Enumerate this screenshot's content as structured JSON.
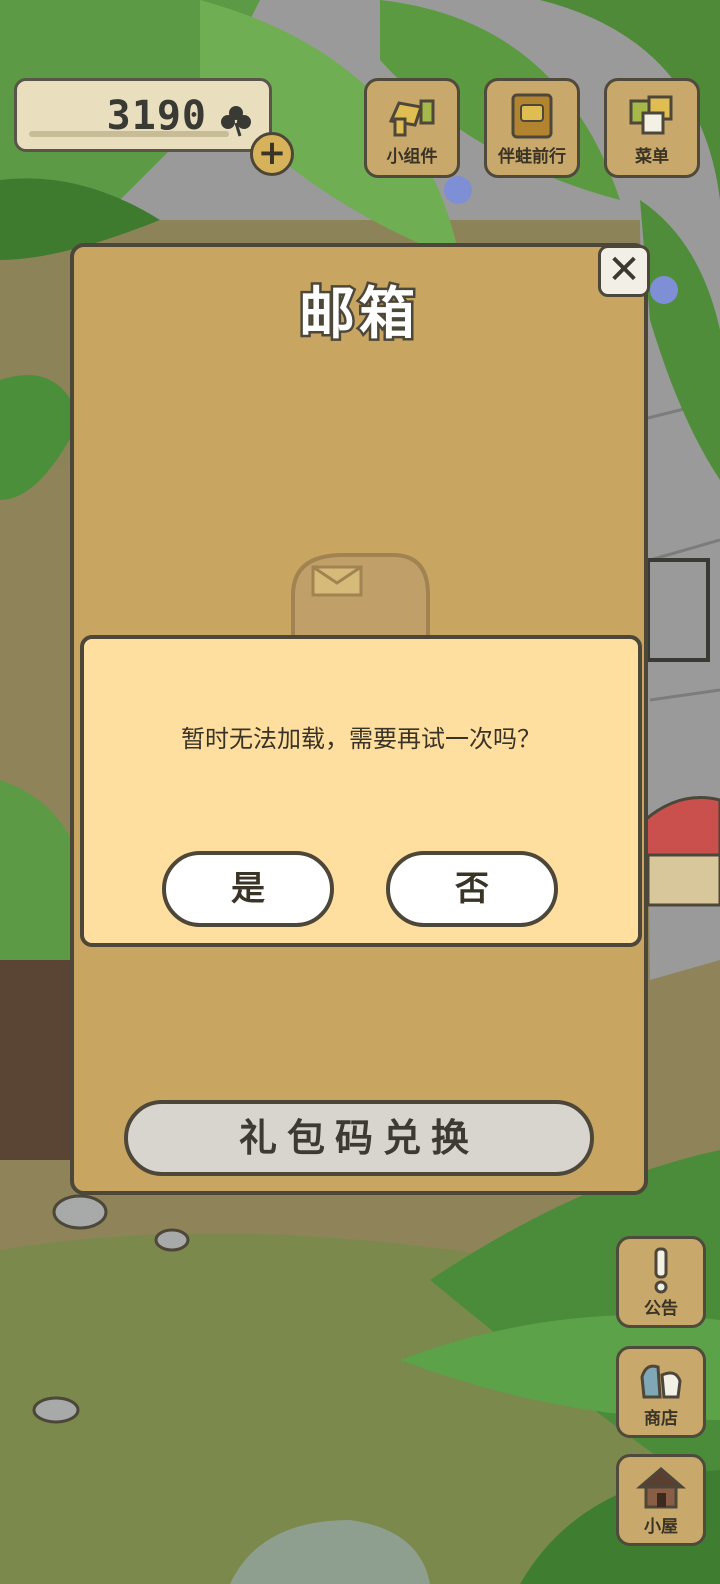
{
  "clovers": {
    "count": "3190"
  },
  "top_menu": [
    {
      "label": "小组件",
      "icon": "widget-icon"
    },
    {
      "label": "伴蛙前行",
      "icon": "frog-companion-icon"
    },
    {
      "label": "菜单",
      "icon": "menu-icon"
    }
  ],
  "mailbox": {
    "title": "邮箱",
    "redeem_label": "礼包码兑换"
  },
  "dialog": {
    "message": "暂时无法加载，需要再试一次吗？",
    "yes_label": "是",
    "no_label": "否"
  },
  "side_menu": [
    {
      "label": "公告",
      "icon": "announcement-icon"
    },
    {
      "label": "商店",
      "icon": "shop-icon"
    },
    {
      "label": "小屋",
      "icon": "house-icon"
    }
  ],
  "colors": {
    "panel": "#c8a561",
    "dialog": "#ffdfa0",
    "outline": "#4d473a",
    "foliage": "#4f8d3a"
  }
}
